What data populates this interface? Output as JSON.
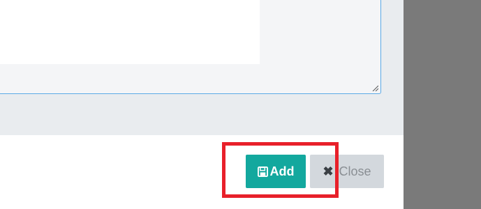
{
  "dialog": {
    "notes_value": "",
    "footer": {
      "add_label": "Add",
      "add_icon": "save-icon",
      "close_label": "Close",
      "close_icon": "close-icon"
    }
  },
  "colors": {
    "add_button": "#13a89e",
    "close_button": "#d3d8dd",
    "highlight": "#e8202a",
    "textarea_border": "#5aa9e6"
  }
}
